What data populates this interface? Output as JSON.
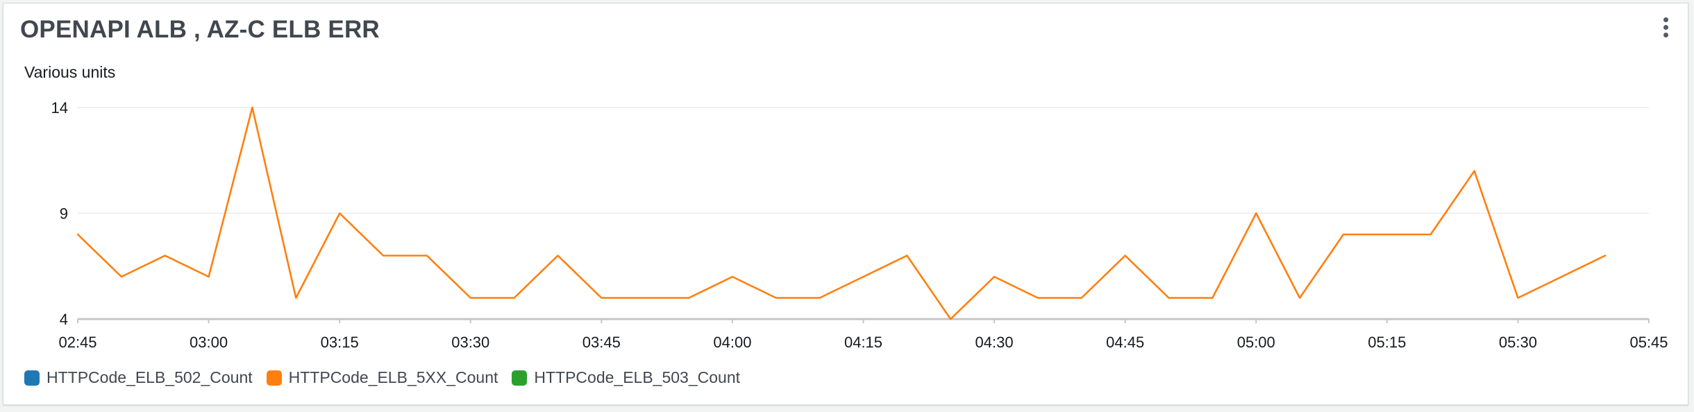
{
  "widget": {
    "title": "OPENAPI ALB , AZ-C ELB ERR",
    "menu_icon": "more-vertical-icon"
  },
  "chart_data": {
    "type": "line",
    "title": "OPENAPI ALB , AZ-C ELB ERR",
    "ylabel": "Various units",
    "xlabel": "",
    "ylim": [
      4,
      14
    ],
    "yticks": [
      4,
      9,
      14
    ],
    "xlim": [
      "02:45",
      "05:45"
    ],
    "xticks": [
      "02:45",
      "03:00",
      "03:15",
      "03:30",
      "03:45",
      "04:00",
      "04:15",
      "04:30",
      "04:45",
      "05:00",
      "05:15",
      "05:30",
      "05:45"
    ],
    "grid": true,
    "legend_position": "bottom",
    "series": [
      {
        "name": "HTTPCode_ELB_502_Count",
        "color": "#1f77b4",
        "x": [],
        "y": []
      },
      {
        "name": "HTTPCode_ELB_5XX_Count",
        "color": "#ff7f0e",
        "x": [
          "02:45",
          "02:50",
          "02:55",
          "03:00",
          "03:05",
          "03:10",
          "03:15",
          "03:20",
          "03:25",
          "03:30",
          "03:35",
          "03:40",
          "03:45",
          "03:50",
          "03:55",
          "04:00",
          "04:05",
          "04:10",
          "04:15",
          "04:20",
          "04:25",
          "04:30",
          "04:35",
          "04:40",
          "04:45",
          "04:50",
          "04:55",
          "05:00",
          "05:05",
          "05:10",
          "05:15",
          "05:20",
          "05:25",
          "05:30",
          "05:35",
          "05:40"
        ],
        "y": [
          8,
          6,
          7,
          6,
          14,
          5,
          9,
          7,
          7,
          5,
          5,
          7,
          5,
          5,
          5,
          6,
          5,
          5,
          6,
          7,
          4,
          6,
          5,
          5,
          7,
          5,
          5,
          9,
          5,
          8,
          8,
          8,
          11,
          5,
          6,
          7
        ]
      },
      {
        "name": "HTTPCode_ELB_503_Count",
        "color": "#2ca02c",
        "x": [],
        "y": []
      }
    ]
  }
}
